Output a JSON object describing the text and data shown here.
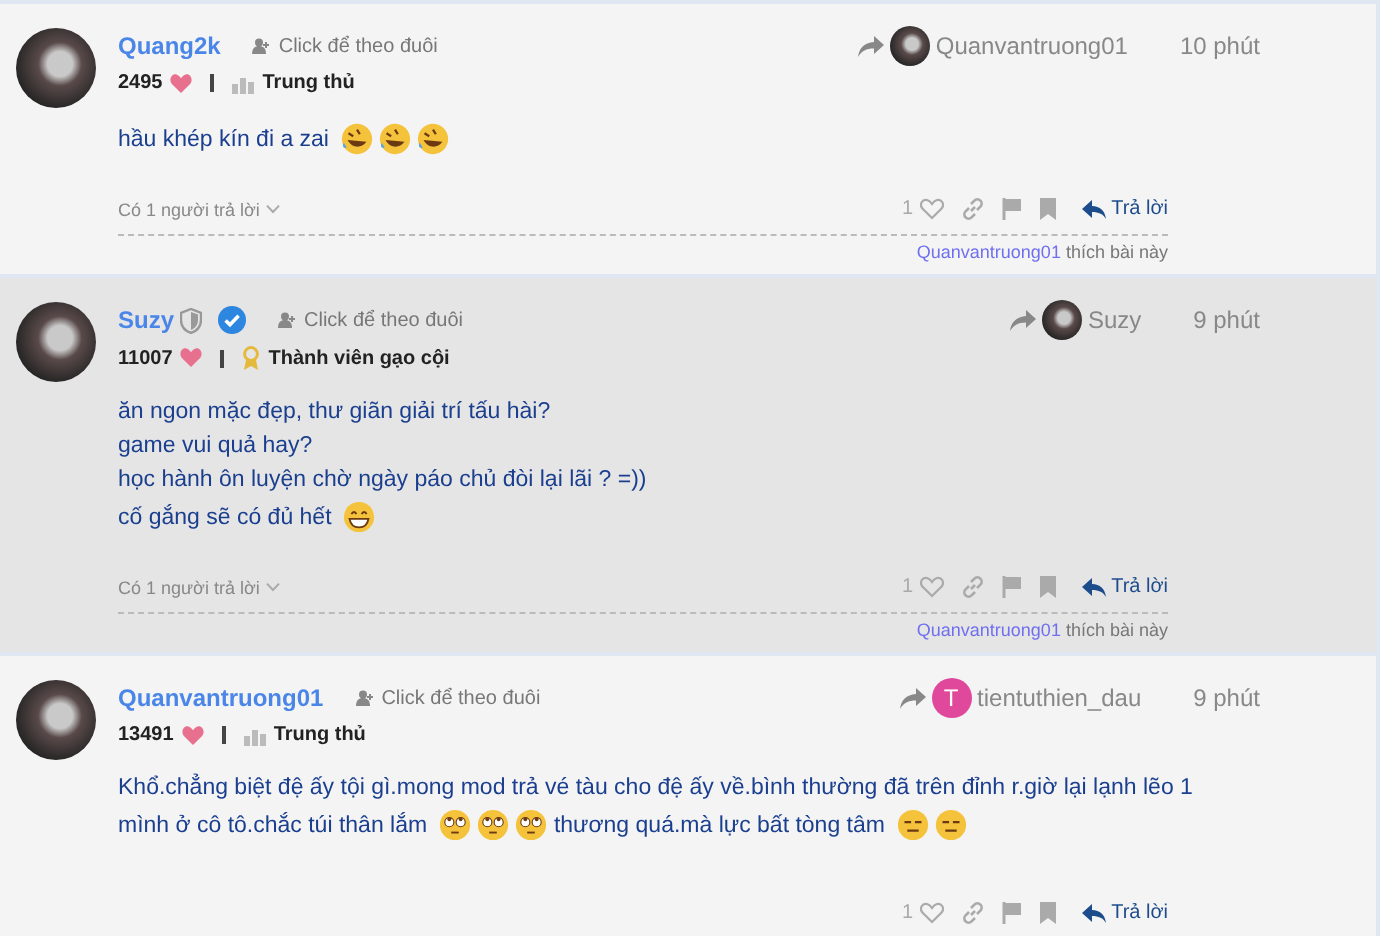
{
  "posts": [
    {
      "author": "Quang2k",
      "moderator": false,
      "verified": false,
      "follow": "Click để theo đuôi",
      "reply_to": {
        "name": "Quanvantruong01",
        "avatar": {
          "kind": "photo"
        }
      },
      "time": "10 phút",
      "likes_total": "2495",
      "badge": {
        "label": "Trung thủ",
        "kind": "trophy"
      },
      "highlighted": false,
      "lines": [
        [
          {
            "kind": "text",
            "text": "hầu khép kín đi a zai "
          },
          {
            "kind": "rofl"
          },
          {
            "kind": "rofl"
          },
          {
            "kind": "rofl"
          }
        ]
      ],
      "replies": "Có 1 người trả lời",
      "like_count": "1",
      "reply_button": "Trả lời",
      "liked_by": "Quanvantruong01",
      "liked_suffix": "thích bài này"
    },
    {
      "author": "Suzy",
      "moderator": true,
      "verified": true,
      "follow": "Click để theo đuôi",
      "reply_to": {
        "name": "Suzy",
        "avatar": {
          "kind": "photo"
        }
      },
      "time": "9 phút",
      "likes_total": "11007",
      "badge": {
        "label": "Thành viên gạo cội",
        "kind": "medal"
      },
      "highlighted": true,
      "lines": [
        [
          {
            "kind": "text",
            "text": "ăn ngon mặc đẹp, thư giãn giải trí tấu hài?"
          }
        ],
        [
          {
            "kind": "text",
            "text": "game vui quả hay?"
          }
        ],
        [
          {
            "kind": "text",
            "text": "học hành ôn luyện chờ ngày páo chủ đòi lại lãi ? =))"
          }
        ],
        [
          {
            "kind": "text",
            "text": "cố gắng sẽ có đủ hết "
          },
          {
            "kind": "grin"
          }
        ]
      ],
      "replies": "Có 1 người trả lời",
      "like_count": "1",
      "reply_button": "Trả lời",
      "liked_by": "Quanvantruong01",
      "liked_suffix": "thích bài này"
    },
    {
      "author": "Quanvantruong01",
      "moderator": false,
      "verified": false,
      "follow": "Click để theo đuôi",
      "reply_to": {
        "name": "tientuthien_dau",
        "avatar": {
          "kind": "letter",
          "letter": "T",
          "color": "#e0489c"
        }
      },
      "time": "9 phút",
      "likes_total": "13491",
      "badge": {
        "label": "Trung thủ",
        "kind": "trophy"
      },
      "highlighted": false,
      "lines": [
        [
          {
            "kind": "text",
            "text": "Khổ.chẳng biệt đệ ấy tội gì.mong mod trả vé tàu cho đệ ấy về.bình thường đã trên đỉnh r.giờ lại lạnh lẽo 1"
          }
        ],
        [
          {
            "kind": "text",
            "text": "mình ở cô tô.chắc túi thân lắm "
          },
          {
            "kind": "eyeroll"
          },
          {
            "kind": "eyeroll"
          },
          {
            "kind": "eyeroll"
          },
          {
            "kind": "text",
            "text": " thương quá.mà lực bất tòng tâm "
          },
          {
            "kind": "expressionless"
          },
          {
            "kind": "expressionless"
          }
        ]
      ],
      "like_count": "1",
      "reply_button": "Trả lời"
    }
  ]
}
